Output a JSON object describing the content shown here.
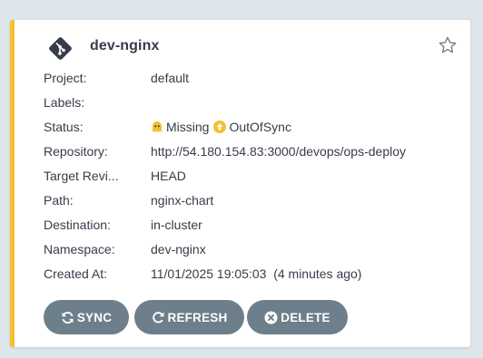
{
  "app": {
    "name": "dev-nginx"
  },
  "fields": [
    {
      "label": "Project:",
      "value": "default"
    },
    {
      "label": "Labels:",
      "value": ""
    },
    {
      "label": "Status:"
    },
    {
      "label": "Repository:",
      "value": "http://54.180.154.83:3000/devops/ops-deploy"
    },
    {
      "label": "Target Revi...",
      "value": "HEAD"
    },
    {
      "label": "Path:",
      "value": "nginx-chart"
    },
    {
      "label": "Destination:",
      "value": "in-cluster"
    },
    {
      "label": "Namespace:",
      "value": "dev-nginx"
    },
    {
      "label": "Created At:",
      "value": "11/01/2025 19:05:03  (4 minutes ago)"
    }
  ],
  "status": {
    "health": "Missing",
    "sync": "OutOfSync",
    "health_color": "#f4c030",
    "sync_color": "#f4c030"
  },
  "buttons": {
    "sync": "SYNC",
    "refresh": "REFRESH",
    "delete": "DELETE"
  },
  "colors": {
    "accent": "#f4c030",
    "button": "#6d7f8b",
    "text": "#363c4a"
  },
  "icons": {
    "app": "git-icon",
    "favorite": "star-outline-icon",
    "health": "ghost-icon",
    "sync_status": "arrow-up-circle-icon",
    "sync_button": "sync-icon",
    "refresh_button": "redo-icon",
    "delete_button": "times-circle-icon"
  }
}
